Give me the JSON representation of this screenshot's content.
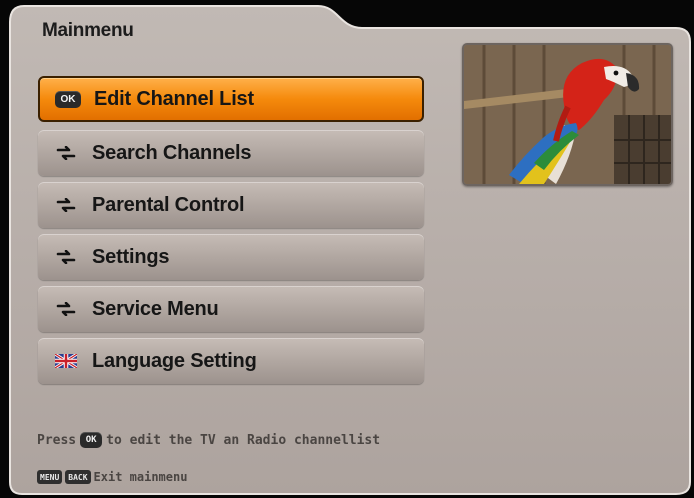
{
  "menu_title": "Mainmenu",
  "menu": {
    "items": [
      {
        "label": "Edit Channel List",
        "icon": "ok-key-icon",
        "icon_text": "OK",
        "selected": true
      },
      {
        "label": "Search Channels",
        "icon": "arrow-icon"
      },
      {
        "label": "Parental Control",
        "icon": "arrow-icon"
      },
      {
        "label": "Settings",
        "icon": "arrow-icon"
      },
      {
        "label": "Service Menu",
        "icon": "arrow-icon"
      },
      {
        "label": "Language Setting",
        "icon": "uk-flag-icon"
      }
    ]
  },
  "help": {
    "prefix": "Press",
    "ok_key": "OK",
    "suffix": "to edit the TV an Radio channellist"
  },
  "footer": {
    "menu_key": "MENU",
    "back_key": "BACK",
    "exit_label": "Exit mainmenu"
  },
  "colors": {
    "panel": "#b3aaa5",
    "selected": "#f58a0c",
    "background": "#060606"
  }
}
